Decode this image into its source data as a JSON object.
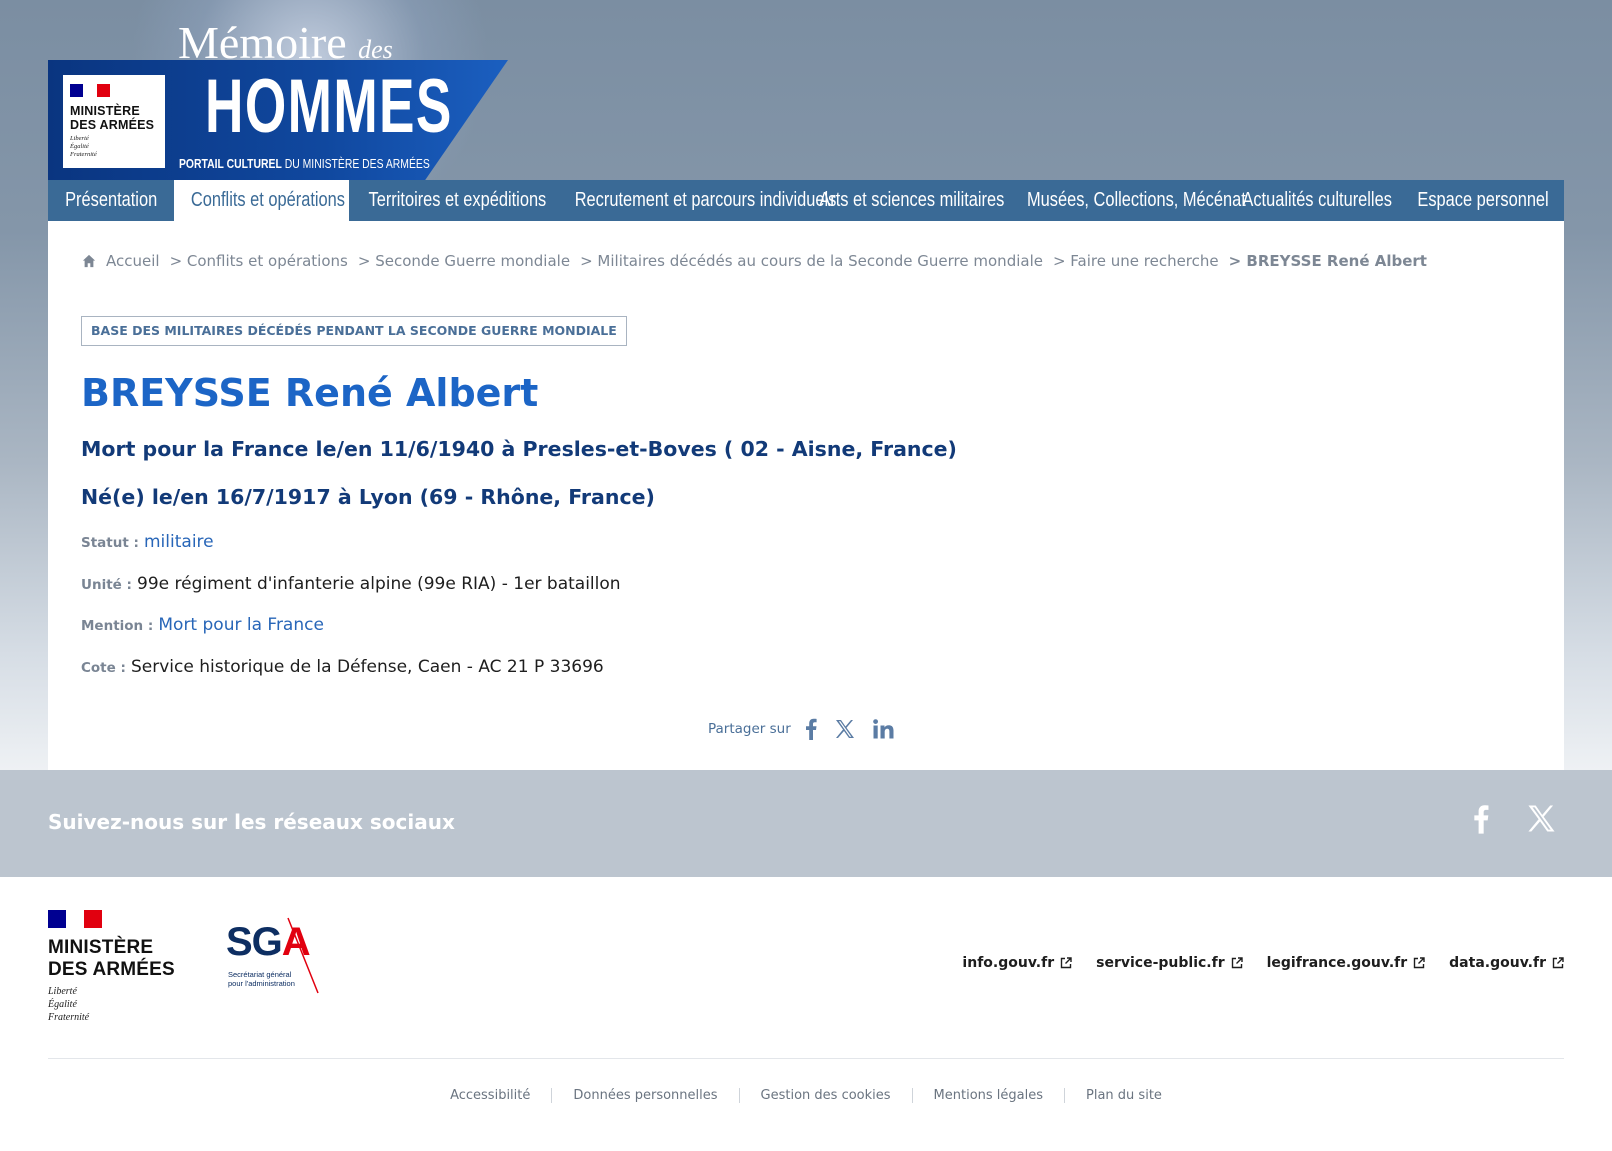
{
  "header": {
    "ministry_name_line1": "MINISTÈRE",
    "ministry_name_line2": "DES ARMÉES",
    "devise_1": "Liberté",
    "devise_2": "Égalité",
    "devise_3": "Fraternité",
    "site_title_memoire": "Mémoire",
    "site_title_des": "des",
    "site_title_hommes": "HOMMES",
    "site_tagline_bold": "PORTAIL CULTUREL",
    "site_tagline_rest": " DU MINISTÈRE DES ARMÉES"
  },
  "nav": {
    "items": [
      {
        "label": "Présentation"
      },
      {
        "label": "Conflits et opérations",
        "active": true
      },
      {
        "label": "Territoires et expéditions"
      },
      {
        "label": "Recrutement et parcours individuels"
      },
      {
        "label": "Arts et sciences militaires"
      },
      {
        "label": "Musées, Collections, Mécénat"
      },
      {
        "label": "Actualités culturelles"
      },
      {
        "label": "Espace personnel"
      }
    ]
  },
  "breadcrumb": {
    "items": [
      "Accueil",
      "> Conflits et opérations",
      "> Seconde Guerre mondiale",
      "> Militaires décédés au cours de la Seconde Guerre mondiale",
      "> Faire une recherche"
    ],
    "current": "> BREYSSE René Albert"
  },
  "record": {
    "database_badge": "BASE DES MILITAIRES DÉCÉDÉS PENDANT LA SECONDE GUERRE MONDIALE",
    "name": "BREYSSE René Albert",
    "death": "Mort pour la France le/en 11/6/1940 à Presles-et-Boves ( 02 - Aisne, France)",
    "birth": "Né(e) le/en 16/7/1917 à Lyon (69 - Rhône, France)",
    "fields": {
      "statut_label": "Statut :",
      "statut_value": "militaire",
      "unite_label": "Unité :",
      "unite_value": "99e régiment d'infanterie alpine (99e RIA) - 1er bataillon",
      "mention_label": "Mention :",
      "mention_value": "Mort pour la France",
      "cote_label": "Cote :",
      "cote_value": "Service historique de la Défense, Caen - AC 21 P 33696"
    }
  },
  "share": {
    "label": "Partager sur",
    "icons": [
      "facebook-icon",
      "x-icon",
      "linkedin-icon"
    ]
  },
  "social_band": {
    "title": "Suivez-nous sur les réseaux sociaux",
    "icons": [
      "facebook-icon",
      "x-icon"
    ]
  },
  "footer": {
    "ministry_name_line1": "MINISTÈRE",
    "ministry_name_line2": "DES ARMÉES",
    "devise_1": "Liberté",
    "devise_2": "Égalité",
    "devise_3": "Fraternité",
    "sga_letters_sg": "SG",
    "sga_letters_a": "A",
    "sga_sub_1": "Secrétariat général",
    "sga_sub_2": "pour l'administration",
    "external_links": [
      "info.gouv.fr",
      "service-public.fr",
      "legifrance.gouv.fr",
      "data.gouv.fr"
    ],
    "legal_links": [
      "Accessibilité",
      "Données personnelles",
      "Gestion des cookies",
      "Mentions légales",
      "Plan du site"
    ]
  },
  "colors": {
    "nav_bg": "#3a6a96",
    "name_blue": "#1c65c6",
    "heading_navy": "#123a78",
    "link_blue": "#2866b8",
    "social_band_bg": "#bcc5cf",
    "marianne_red": "#e1000f",
    "marianne_blue": "#000091"
  }
}
